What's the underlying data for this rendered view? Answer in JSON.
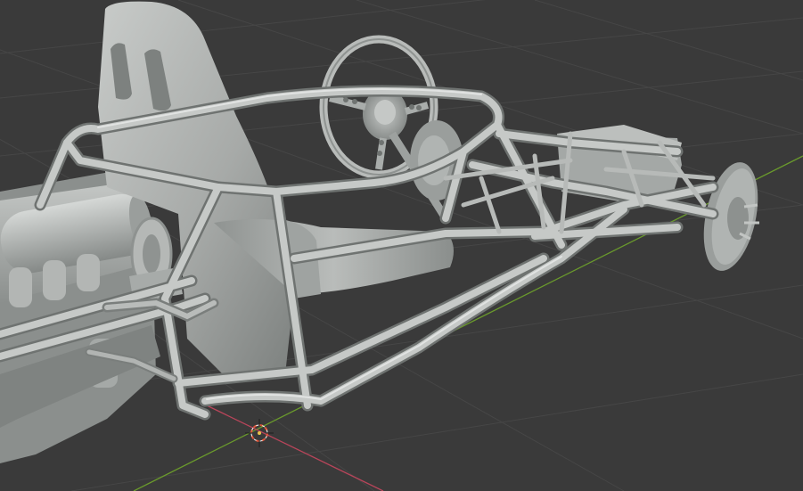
{
  "viewport": {
    "colors": {
      "background": "#3a3a3a",
      "grid": "#464646",
      "axis_x": "#b8455a",
      "axis_y": "#6a9a2c",
      "metal_light": "#c9ccca",
      "metal_mid": "#9fa3a1",
      "metal_dark": "#707472",
      "cursor_red": "#e0583c"
    },
    "icons": {
      "cursor": "3d-cursor-icon"
    }
  }
}
